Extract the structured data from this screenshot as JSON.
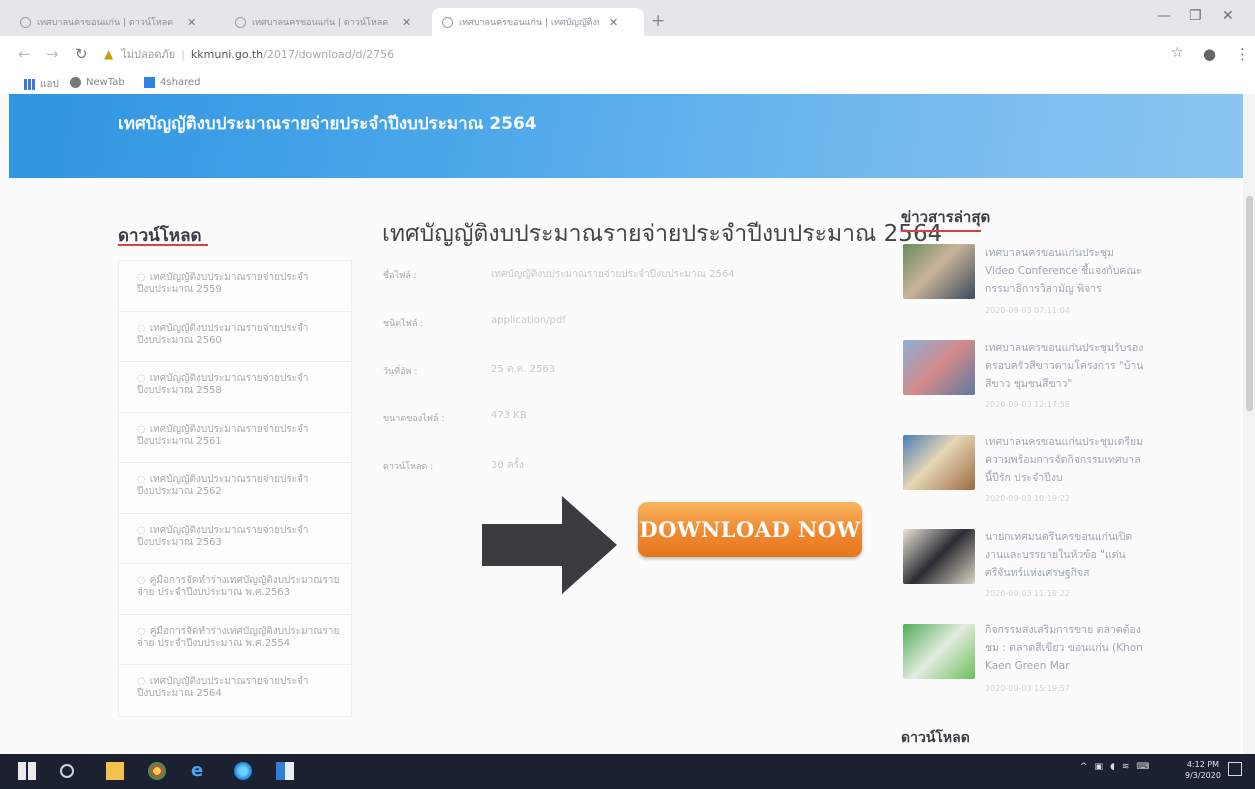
{
  "browser": {
    "tabs": [
      {
        "label": "เทศบาลนครขอนแก่น | ดาวน์โหลด",
        "active": false
      },
      {
        "label": "เทศบาลนครขอนแก่น | ดาวน์โหลด",
        "active": false
      },
      {
        "label": "เทศบาลนครขอนแก่น | เทศบัญญัติงบ",
        "active": true
      }
    ],
    "new_tab_symbol": "+",
    "security_label": "ไม่ปลอดภัย",
    "url_domain": "kkmuni.go.th",
    "url_path": "/2017/download/d/2756",
    "bookmarks": [
      {
        "label": "แอป",
        "icon": "apps-grid-icon"
      },
      {
        "label": "NewTab",
        "icon": "globe-icon"
      },
      {
        "label": "4shared",
        "icon": "4shared-icon"
      }
    ]
  },
  "page": {
    "banner_title": "เทศบัญญัติงบประมาณรายจ่ายประจำปีงบประมาณ 2564",
    "sidebar": {
      "title": "ดาวน์โหลด",
      "items": [
        "เทศบัญญัติงบประมาณรายจ่ายประจำปีงบประมาณ 2559",
        "เทศบัญญัติงบประมาณรายจ่ายประจำปีงบประมาณ 2560",
        "เทศบัญญัติงบประมาณรายจ่ายประจำปีงบประมาณ 2558",
        "เทศบัญญัติงบประมาณรายจ่ายประจำปีงบประมาณ 2561",
        "เทศบัญญัติงบประมาณรายจ่ายประจำปีงบประมาณ 2562",
        "เทศบัญญัติงบประมาณรายจ่ายประจำปีงบประมาณ 2563",
        "คู่มือการจัดทำร่างเทศบัญญัติงบประมาณรายจ่าย ประจำปีงบประมาณ พ.ศ.2563",
        "คู่มือการจัดทำร่างเทศบัญญัติงบประมาณรายจ่าย ประจำปีงบประมาณ พ.ศ.2554",
        "เทศบัญญัติงบประมาณรายจ่ายประจำปีงบประมาณ 2564"
      ]
    },
    "main": {
      "title": "เทศบัญญัติงบประมาณรายจ่ายประจำปีงบประมาณ 2564",
      "fields": [
        {
          "label": "ชื่อไฟล์ :",
          "value": "เทศบัญญัติงบประมาณรายจ่ายประจำปีงบประมาณ 2564"
        },
        {
          "label": "ชนิดไฟล์ :",
          "value": "application/pdf"
        },
        {
          "label": "วันที่อัพ :",
          "value": "25 ต.ค. 2563"
        },
        {
          "label": "ขนาดของไฟล์ :",
          "value": "473 KB"
        },
        {
          "label": "ดาวน์โหลด :",
          "value": "30 ครั้ง"
        }
      ],
      "download_button": "DOWNLOAD NOW"
    },
    "news": {
      "title": "ข่าวสารล่าสุด",
      "items": [
        {
          "text": "เทศบาลนครขอนแก่นประชุม Video Conference ชี้แจงกับคณะกรรมาธิการวิสามัญ พิจาร",
          "date": "2020-09-03 07:11:04"
        },
        {
          "text": "เทศบาลนครขอนแก่นประชุมรับรองครอบครัวสีขาวตามโครงการ \"บ้านสีขาว ชุมชนสีขาว\"",
          "date": "2020-09-03 12:17:58"
        },
        {
          "text": "เทศบาลนครขอนแก่นประชุมเตรียมความพร้อมการจัดกิจกรรมเทศบาลนี้ปีรัก ประจำปีงบ",
          "date": "2020-09-03 10:19:22"
        },
        {
          "text": "นายกเทศมนตรีนครขอนแก่นเปิดงานและบรรยายในหัวข้อ \"แด่นศรีจันทร์แห่งเศรษฐกิจส",
          "date": "2020-09-03 11:19:22"
        },
        {
          "text": "กิจกรรมส่งเสริมการขาย ตลาดต้องชม : ตลาดสีเขียว ขอนแก่น (Khon Kaen Green Mar",
          "date": "2020-09-03 15:19:57"
        }
      ],
      "downloads_title": "ดาวน์โหลด"
    }
  },
  "taskbar": {
    "clock_time": "4:12 PM",
    "clock_date": "9/3/2020"
  },
  "colors": {
    "banner": "#3d9fe6",
    "accent_red": "#d7414b",
    "download_orange": "#f08930"
  }
}
